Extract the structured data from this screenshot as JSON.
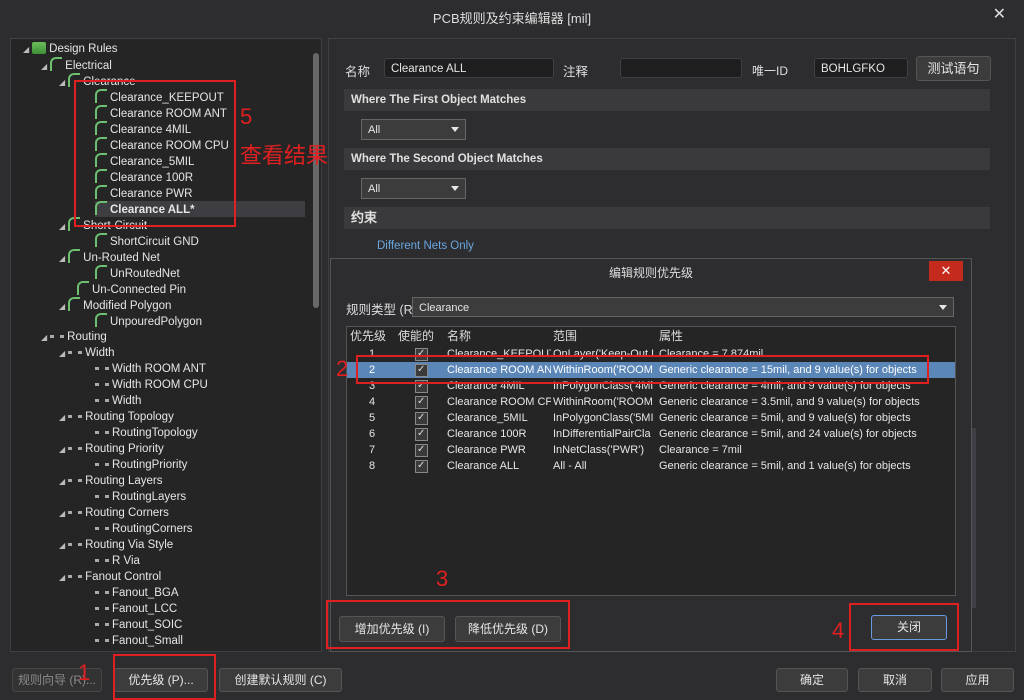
{
  "window": {
    "title": "PCB规则及约束编辑器 [mil]"
  },
  "tree": {
    "root": "Design Rules",
    "electrical": "Electrical",
    "clearance": "Clearance",
    "clearance_items": [
      "Clearance_KEEPOUT",
      "Clearance ROOM ANT",
      "Clearance 4MIL",
      "Clearance ROOM CPU",
      "Clearance_5MIL",
      "Clearance 100R",
      "Clearance PWR",
      "Clearance ALL*"
    ],
    "short_circuit": "Short-Circuit",
    "short_circuit_item": "ShortCircuit GND",
    "unrouted": "Un-Routed Net",
    "unrouted_item": "UnRoutedNet",
    "unconnected": "Un-Connected Pin",
    "modified_polygon": "Modified Polygon",
    "modified_polygon_item": "UnpouredPolygon",
    "routing": "Routing",
    "width": "Width",
    "width_items": [
      "Width ROOM ANT",
      "Width ROOM CPU",
      "Width"
    ],
    "routing_topology": "Routing Topology",
    "routing_topology_item": "RoutingTopology",
    "routing_priority": "Routing Priority",
    "routing_priority_item": "RoutingPriority",
    "routing_layers": "Routing Layers",
    "routing_layers_item": "RoutingLayers",
    "routing_corners": "Routing Corners",
    "routing_corners_item": "RoutingCorners",
    "routing_via_style": "Routing Via Style",
    "routing_via_item": "R Via",
    "fanout_control": "Fanout Control",
    "fanout_items": [
      "Fanout_BGA",
      "Fanout_LCC",
      "Fanout_SOIC",
      "Fanout_Small"
    ]
  },
  "rule": {
    "name_label": "名称",
    "name_value": "Clearance ALL",
    "comment_label": "注释",
    "comment_value": "",
    "uid_label": "唯一ID",
    "uid_value": "BOHLGFKO",
    "test_button": "测试语句",
    "first_match": "Where The First Object Matches",
    "first_select": "All",
    "second_match": "Where The Second Object Matches",
    "second_select": "All",
    "constraints": "约束",
    "diff_nets": "Different Nets Only"
  },
  "dialog": {
    "title": "编辑规则优先级",
    "close_x": "✕",
    "rule_type_label": "规则类型 (R",
    "rule_type_value": "Clearance",
    "columns": [
      "优先级",
      "使能的",
      "名称",
      "范围",
      "属性"
    ],
    "rows": [
      {
        "p": "1",
        "name": "Clearance_KEEPOUT",
        "scope": "OnLayer('Keep-Out L",
        "attr": "Clearance = 7.874mil"
      },
      {
        "p": "2",
        "name": "Clearance ROOM ANT",
        "scope": "WithinRoom('ROOM",
        "attr": "Generic clearance = 15mil, and 9 value(s) for objects"
      },
      {
        "p": "3",
        "name": "Clearance 4MIL",
        "scope": "InPolygonClass('4Mi",
        "attr": "Generic clearance = 4mil, and 9 value(s) for objects"
      },
      {
        "p": "4",
        "name": "Clearance ROOM CPU",
        "scope": "WithinRoom('ROOM",
        "attr": "Generic clearance = 3.5mil, and 9 value(s) for objects"
      },
      {
        "p": "5",
        "name": "Clearance_5MIL",
        "scope": "InPolygonClass('5MI",
        "attr": "Generic clearance = 5mil, and 9 value(s) for objects"
      },
      {
        "p": "6",
        "name": "Clearance 100R",
        "scope": "InDifferentialPairCla",
        "attr": "Generic clearance = 5mil, and 24 value(s) for objects"
      },
      {
        "p": "7",
        "name": "Clearance PWR",
        "scope": "InNetClass('PWR')",
        "attr": "Clearance = 7mil"
      },
      {
        "p": "8",
        "name": "Clearance ALL",
        "scope": "All   -   All",
        "attr": "Generic clearance = 5mil, and 1 value(s) for objects"
      }
    ],
    "increase_btn": "增加优先级 (I)",
    "decrease_btn": "降低优先级 (D)",
    "close_btn": "关闭"
  },
  "bottom": {
    "wizard": "规则向导 (R)...",
    "priority": "优先级 (P)...",
    "create_default": "创建默认规则 (C)",
    "ok": "确定",
    "cancel": "取消",
    "apply": "应用"
  },
  "annotations": {
    "n1": "1",
    "n2": "2",
    "n3": "3",
    "n4": "4",
    "n5": "5",
    "n5_text": "查看结果"
  },
  "colors": {
    "annotation": "#e02020",
    "selection": "#5b86b8",
    "close_red": "#c42b1c"
  }
}
